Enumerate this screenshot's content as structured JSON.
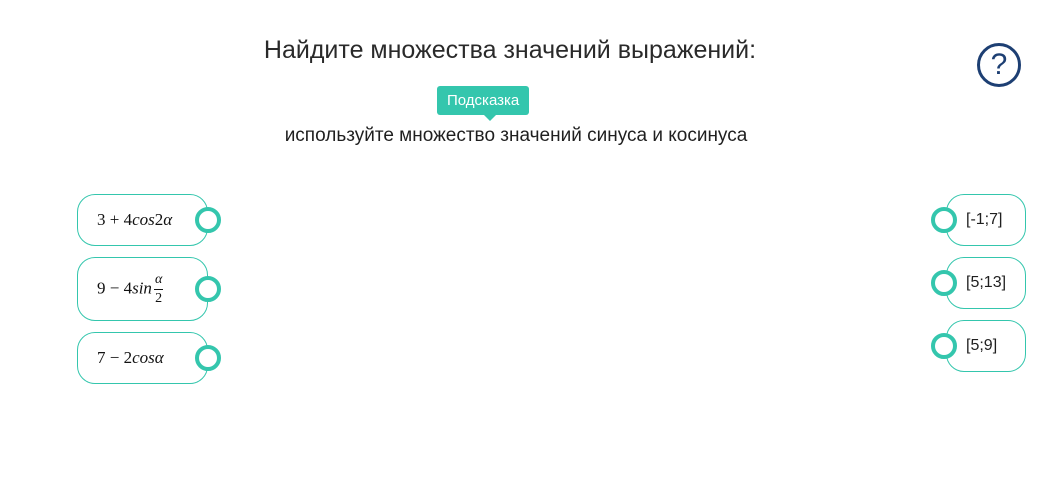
{
  "task": {
    "title": "Найдите множества значений выражений:",
    "help_symbol": "?",
    "hint_label": "Подсказка",
    "hint_text": "используйте множество значений синуса и косинуса"
  },
  "left_items": [
    {
      "expr": "3 + 4cos2α",
      "parts": {
        "a": "3 + 4",
        "fn": "cos",
        "b": "2",
        "var": "α"
      }
    },
    {
      "expr": "9 − 4sin α/2",
      "parts": {
        "a": "9 − 4",
        "fn": "sin",
        "num": "α",
        "den": "2"
      }
    },
    {
      "expr": "7 − 2cosα",
      "parts": {
        "a": "7 − 2",
        "fn": "cos",
        "var": "α"
      }
    }
  ],
  "right_items": [
    {
      "label": "[-1;7]"
    },
    {
      "label": "[5;13]"
    },
    {
      "label": "[5;9]"
    }
  ],
  "colors": {
    "accent": "#34c6ad",
    "help": "#1d3f73",
    "text": "#1f1f1f"
  }
}
